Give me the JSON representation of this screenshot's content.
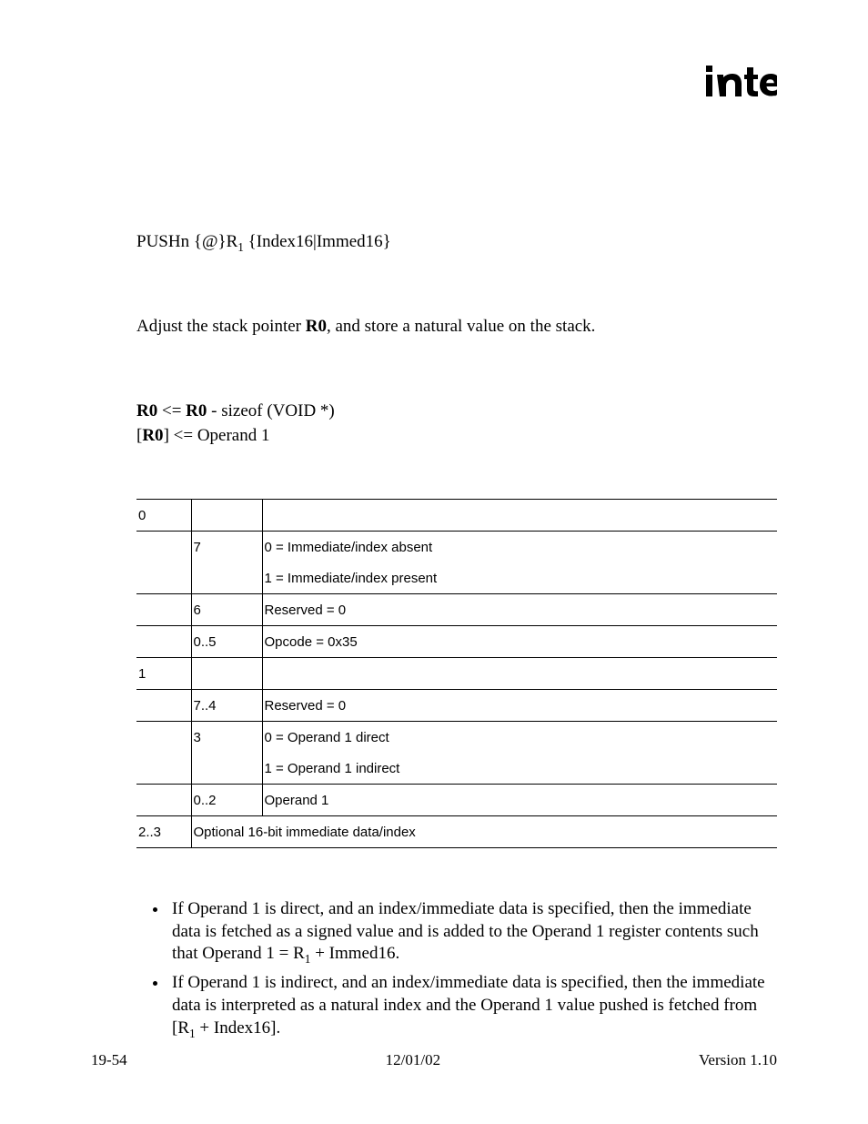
{
  "logo_alt": "intel",
  "syntax": {
    "prefix": "PUSHn {@}R",
    "sub": "1",
    "suffix": " {Index16|Immed16}"
  },
  "description": {
    "pre": "Adjust the stack pointer ",
    "reg": "R0",
    "post": ", and store a natural value on the stack."
  },
  "operation": {
    "line1_pre": "R0",
    "line1_mid": " <= ",
    "line1_reg2": "R0",
    "line1_post": " - sizeof (VOID *)",
    "line2_pre": "[",
    "line2_reg": "R0",
    "line2_post": "] <= Operand 1"
  },
  "table": [
    {
      "byte": "0",
      "bits": "",
      "desc": "",
      "header": true
    },
    {
      "byte": "",
      "bits": "7",
      "desc": "0 = Immediate/index absent"
    },
    {
      "byte": "",
      "bits": "",
      "desc": "1 = Immediate/index present",
      "no_top": true
    },
    {
      "byte": "",
      "bits": "6",
      "desc": "Reserved = 0"
    },
    {
      "byte": "",
      "bits": "0..5",
      "desc": "Opcode = 0x35"
    },
    {
      "byte": "1",
      "bits": "",
      "desc": ""
    },
    {
      "byte": "",
      "bits": "7..4",
      "desc": "Reserved = 0"
    },
    {
      "byte": "",
      "bits": "3",
      "desc": "0 = Operand 1 direct"
    },
    {
      "byte": "",
      "bits": "",
      "desc": "1 = Operand 1 indirect",
      "no_top": true
    },
    {
      "byte": "",
      "bits": "0..2",
      "desc": "Operand 1"
    },
    {
      "byte": "2..3",
      "bits_span_desc": "Optional 16-bit immediate data/index",
      "last": true
    }
  ],
  "bullets": [
    {
      "p1": "If Operand 1 is direct, and an index/immediate data is specified, then the immediate data is fetched as a signed value and is added to the Operand 1 register contents such that Operand 1 = R",
      "sub": "1",
      "p2": " + Immed16."
    },
    {
      "p1": "If Operand 1 is indirect, and an index/immediate data is specified, then the immediate data is interpreted as a natural index and the Operand 1 value pushed is fetched from [R",
      "sub": "1",
      "p2": " + Index16]."
    }
  ],
  "footer": {
    "page": "19-54",
    "date": "12/01/02",
    "version": "Version 1.10"
  }
}
